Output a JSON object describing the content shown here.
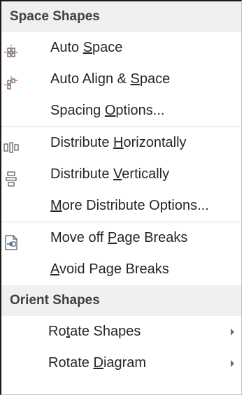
{
  "sections": {
    "space_title": "Space Shapes",
    "orient_title": "Orient Shapes"
  },
  "items": {
    "auto_space": {
      "pre": "Auto ",
      "acc": "S",
      "post": "pace"
    },
    "auto_align_space": {
      "pre": "Auto Align & ",
      "acc": "S",
      "post": "pace"
    },
    "spacing_options": {
      "pre": "Spacing ",
      "acc": "O",
      "post": "ptions..."
    },
    "dist_horiz": {
      "pre": "Distribute ",
      "acc": "H",
      "post": "orizontally"
    },
    "dist_vert": {
      "pre": "Distribute ",
      "acc": "V",
      "post": "ertically"
    },
    "more_dist": {
      "pre": "",
      "acc": "M",
      "post": "ore Distribute Options..."
    },
    "move_off_breaks": {
      "pre": "Move off ",
      "acc": "P",
      "post": "age Breaks"
    },
    "avoid_breaks": {
      "pre": "",
      "acc": "A",
      "post": "void Page Breaks"
    },
    "rotate_shapes": {
      "pre": "Ro",
      "acc": "t",
      "post": "ate Shapes"
    },
    "rotate_diagram": {
      "pre": "Rotate ",
      "acc": "D",
      "post": "iagram"
    }
  },
  "icons": {
    "auto_space": "auto-space-icon",
    "auto_align_space": "auto-align-space-icon",
    "dist_horiz": "distribute-horizontally-icon",
    "dist_vert": "distribute-vertically-icon",
    "move_off_breaks": "move-off-page-breaks-icon",
    "submenu_arrow": "chevron-right-icon"
  },
  "colors": {
    "accent_red": "#d9392b",
    "icon_blue": "#2b6cb0",
    "icon_gray": "#555555",
    "header_bg": "#f0f0f0"
  }
}
